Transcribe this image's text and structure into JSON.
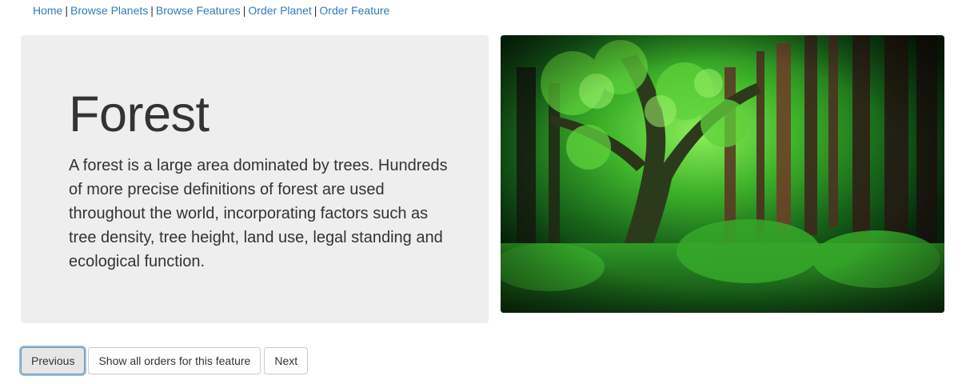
{
  "nav": {
    "items": [
      {
        "label": "Home"
      },
      {
        "label": "Browse Planets"
      },
      {
        "label": "Browse Features"
      },
      {
        "label": "Order Planet"
      },
      {
        "label": "Order Feature"
      }
    ],
    "separator": "|"
  },
  "feature": {
    "title": "Forest",
    "description": "A forest is a large area dominated by trees. Hundreds of more precise definitions of forest are used throughout the world, incorporating factors such as tree density, tree height, land use, legal standing and ecological function.",
    "image_alt": "forest-photo"
  },
  "actions": {
    "previous_label": "Previous",
    "show_orders_label": "Show all orders for this feature",
    "next_label": "Next"
  },
  "colors": {
    "link": "#337ab7",
    "jumbotron_bg": "#eeeeee",
    "text": "#333333"
  }
}
